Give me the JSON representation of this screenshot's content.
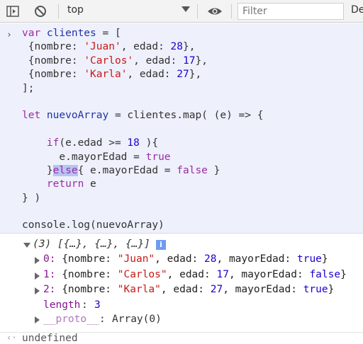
{
  "toolbar": {
    "context": "top",
    "filter_placeholder": "Filter",
    "default_levels_label": "De"
  },
  "input": {
    "prompt_glyph": "›",
    "lines": [
      [
        {
          "t": "var ",
          "c": "kw"
        },
        {
          "t": "clientes",
          "c": "vn"
        },
        {
          "t": " = [",
          "c": "op"
        }
      ],
      [
        {
          "t": " {nombre: ",
          "c": "op"
        },
        {
          "t": "'Juan'",
          "c": "str"
        },
        {
          "t": ", edad: ",
          "c": "op"
        },
        {
          "t": "28",
          "c": "num"
        },
        {
          "t": "},",
          "c": "op"
        }
      ],
      [
        {
          "t": " {nombre: ",
          "c": "op"
        },
        {
          "t": "'Carlos'",
          "c": "str"
        },
        {
          "t": ", edad: ",
          "c": "op"
        },
        {
          "t": "17",
          "c": "num"
        },
        {
          "t": "},",
          "c": "op"
        }
      ],
      [
        {
          "t": " {nombre: ",
          "c": "op"
        },
        {
          "t": "'Karla'",
          "c": "str"
        },
        {
          "t": ", edad: ",
          "c": "op"
        },
        {
          "t": "27",
          "c": "num"
        },
        {
          "t": "},",
          "c": "op"
        }
      ],
      [
        {
          "t": "];",
          "c": "op"
        }
      ],
      [],
      [
        {
          "t": "let ",
          "c": "kw"
        },
        {
          "t": "nuevoArray",
          "c": "vn"
        },
        {
          "t": " = clientes.map( (e) => {",
          "c": "op"
        }
      ],
      [],
      [
        {
          "t": "    if",
          "c": "kw"
        },
        {
          "t": "(e.edad >= ",
          "c": "op"
        },
        {
          "t": "18",
          "c": "num"
        },
        {
          "t": " ){",
          "c": "op"
        }
      ],
      [
        {
          "t": "      e.mayorEdad = ",
          "c": "op"
        },
        {
          "t": "true",
          "c": "kw"
        }
      ],
      [
        {
          "t": "    }",
          "c": "op"
        },
        {
          "t": "else",
          "c": "kw hl"
        },
        {
          "t": "{ e.mayorEdad = ",
          "c": "op"
        },
        {
          "t": "false",
          "c": "kw"
        },
        {
          "t": " }",
          "c": "op"
        }
      ],
      [
        {
          "t": "    return ",
          "c": "kw"
        },
        {
          "t": "e",
          "c": "op"
        }
      ],
      [
        {
          "t": "} )",
          "c": "op"
        }
      ],
      [],
      [
        {
          "t": "console.log(nuevoArray)",
          "c": "op"
        }
      ]
    ]
  },
  "output": {
    "summary_italic": "(3) [{…}, {…}, {…}]",
    "info_glyph": "i",
    "items": [
      {
        "index": "0:",
        "nombre": "\"Juan\"",
        "edad": "28",
        "mayor": "true"
      },
      {
        "index": "1:",
        "nombre": "\"Carlos\"",
        "edad": "17",
        "mayor": "false"
      },
      {
        "index": "2:",
        "nombre": "\"Karla\"",
        "edad": "27",
        "mayor": "true"
      }
    ],
    "length_key": "length",
    "length_val": "3",
    "proto_key": "__proto__",
    "proto_val": "Array(0)",
    "result_glyph": "‹·",
    "result_text": "undefined"
  },
  "colors": {
    "input_bg": "#eef0fb",
    "keyword": "#9a2ca4",
    "string": "#c41a16",
    "number": "#1c00cf"
  }
}
